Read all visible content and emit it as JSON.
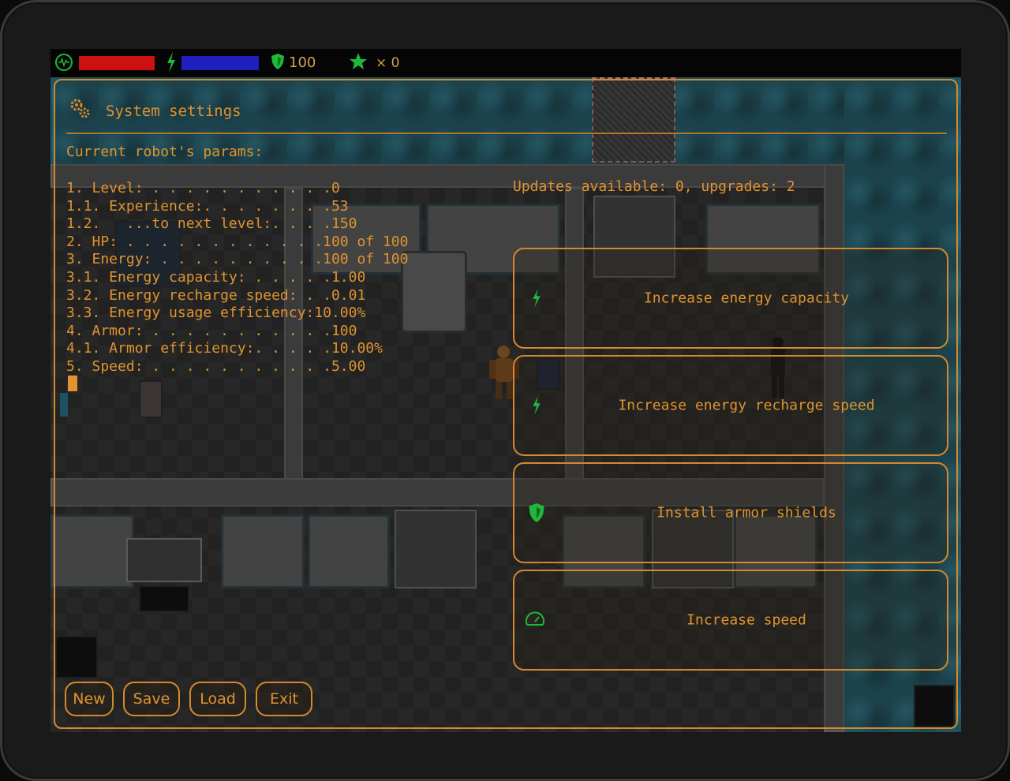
{
  "hud": {
    "armor": "100",
    "star_count": "× 0"
  },
  "dialog": {
    "title": "System settings",
    "subtitle": "Current robot's params:",
    "updates_text": "Updates available: 0, upgrades: 2",
    "params": [
      "1. Level: . . . . . . . . . . .0",
      "1.1. Experience:. . . . . . . .53",
      "1.2.   ...to next level:. . . .150",
      "2. HP: . . . . . . . . . . . .100 of 100",
      "3. Energy: . . . . . . . . . .100 of 100",
      "3.1. Energy capacity: . . . . .1.00",
      "3.2. Energy recharge speed: . .0.01",
      "3.3. Energy usage efficiency:10.00%",
      "4. Armor: . . . . . . . . . . .100",
      "4.1. Armor efficiency:. . . . .10.00%",
      "5. Speed: . . . . . . . . . . .5.00"
    ],
    "upgrades": [
      {
        "label": "Increase energy capacity",
        "icon": "bolt-icon"
      },
      {
        "label": "Increase energy recharge speed",
        "icon": "bolt-icon"
      },
      {
        "label": "Install armor shields",
        "icon": "shield-icon"
      },
      {
        "label": "Increase speed",
        "icon": "speedometer-icon"
      }
    ],
    "buttons": {
      "new": "New",
      "save": "Save",
      "load": "Load",
      "exit": "Exit"
    }
  },
  "colors": {
    "accent": "#e0932f",
    "hp": "#cc1111",
    "energy": "#1f1fbf",
    "icon_green": "#1fb83a"
  }
}
